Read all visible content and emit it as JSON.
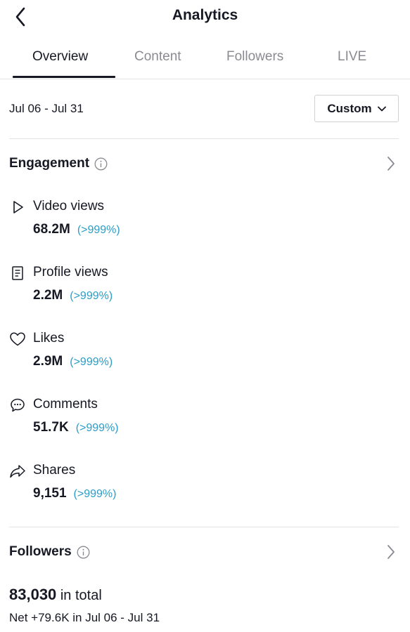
{
  "header": {
    "title": "Analytics"
  },
  "tabs": [
    {
      "label": "Overview",
      "active": true
    },
    {
      "label": "Content",
      "active": false
    },
    {
      "label": "Followers",
      "active": false
    },
    {
      "label": "LIVE",
      "active": false
    }
  ],
  "date_range": {
    "text": "Jul 06 - Jul 31",
    "selector_label": "Custom"
  },
  "engagement": {
    "title": "Engagement",
    "metrics": [
      {
        "icon": "play-icon",
        "label": "Video views",
        "value": "68.2M",
        "change": "(>999%)"
      },
      {
        "icon": "profile-icon",
        "label": "Profile views",
        "value": "2.2M",
        "change": "(>999%)"
      },
      {
        "icon": "heart-icon",
        "label": "Likes",
        "value": "2.9M",
        "change": "(>999%)"
      },
      {
        "icon": "comment-icon",
        "label": "Comments",
        "value": "51.7K",
        "change": "(>999%)"
      },
      {
        "icon": "share-icon",
        "label": "Shares",
        "value": "9,151",
        "change": "(>999%)"
      }
    ]
  },
  "followers": {
    "title": "Followers",
    "total": "83,030",
    "total_suffix": "in total",
    "net": "Net +79.6K in Jul 06 - Jul 31"
  },
  "colors": {
    "text": "#161823",
    "muted": "#8a8b91",
    "accent": "#2b9dc6",
    "divider": "#e3e3e4"
  }
}
